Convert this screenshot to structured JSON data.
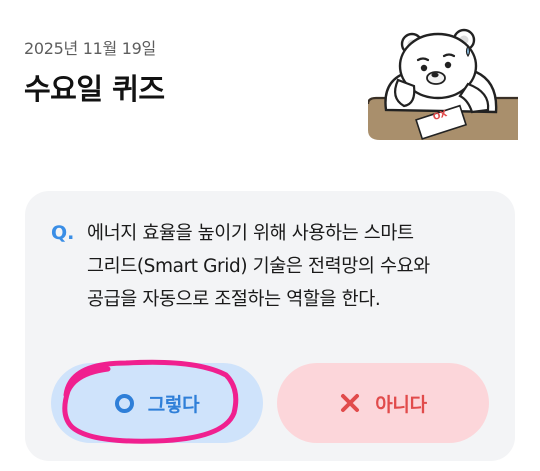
{
  "header": {
    "date": "2025년 11월 19일",
    "title": "수요일 퀴즈"
  },
  "mascot": {
    "icon": "bear-mascot-icon",
    "paper_text": "OX"
  },
  "quiz": {
    "q_mark": "Q.",
    "question_lines": [
      "에너지 효율을 높이기 위해 사용하는 스마트",
      "그리드(Smart Grid) 기술은 전력망의 수요와",
      "공급을 자동으로 조절하는 역할을 한다."
    ],
    "yes_label": "그렇다",
    "no_label": "아니다"
  },
  "colors": {
    "accent_blue": "#2f7fd8",
    "accent_red": "#e14b4b",
    "card_bg": "#f3f4f6",
    "yes_bg": "#cfe3fb",
    "no_bg": "#fcd6da",
    "scribble": "#f0208f"
  }
}
